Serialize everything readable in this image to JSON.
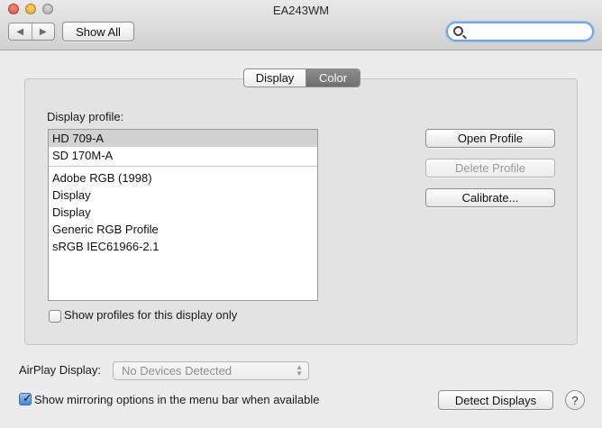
{
  "window": {
    "title": "EA243WM"
  },
  "toolbar": {
    "back_icon": "back-arrow-icon",
    "forward_icon": "forward-arrow-icon",
    "show_all_label": "Show All",
    "search_icon": "magnifying-glass-icon",
    "search_value": ""
  },
  "tabs": [
    {
      "label": "Display",
      "selected": false
    },
    {
      "label": "Color",
      "selected": true
    }
  ],
  "color_panel": {
    "profile_label": "Display profile:",
    "profiles_top": [
      "HD 709-A",
      "SD 170M-A"
    ],
    "profiles_bottom": [
      "Adobe RGB (1998)",
      "Display",
      "Display",
      "Generic RGB Profile",
      "sRGB IEC61966-2.1"
    ],
    "selected_profile": "HD 709-A",
    "open_profile_label": "Open Profile",
    "delete_profile_label": "Delete Profile",
    "calibrate_label": "Calibrate...",
    "show_only_label": "Show profiles for this display only",
    "show_only_checked": false
  },
  "footer": {
    "airplay_label": "AirPlay Display:",
    "airplay_value": "No Devices Detected",
    "mirroring_label": "Show mirroring options in the menu bar when available",
    "mirroring_checked": true,
    "detect_label": "Detect Displays",
    "help_label": "?"
  },
  "colors": {
    "window_bg": "#ececec",
    "selected_tab": "#7a7a7a",
    "selected_row": "#d2d2d2",
    "focus_ring": "#6aa6e8"
  }
}
